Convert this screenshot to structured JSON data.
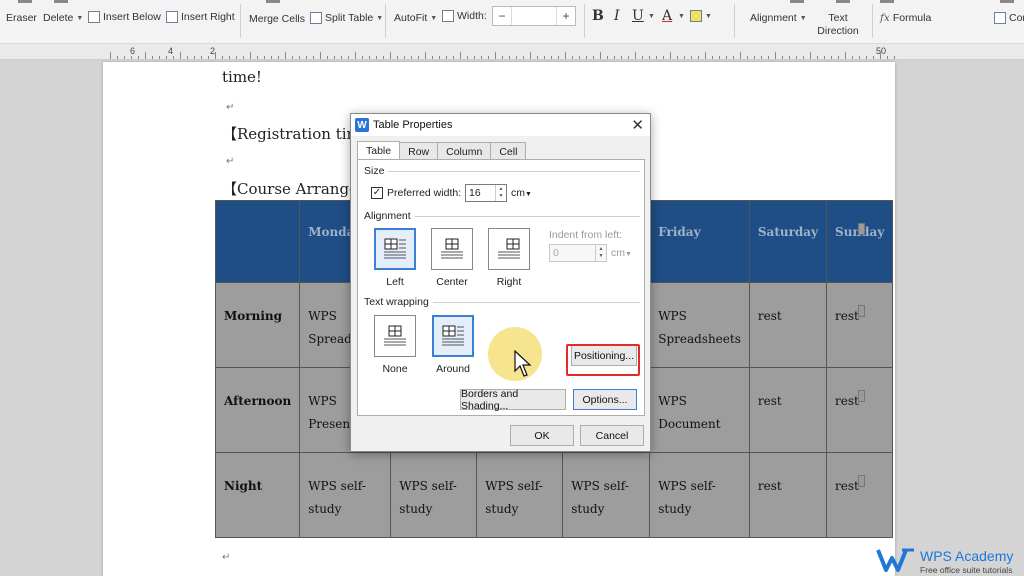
{
  "toolbar": {
    "eraser": "Eraser",
    "delete": "Delete",
    "insert_below": "Insert Below",
    "insert_right": "Insert Right",
    "merge_cells": "Merge Cells",
    "split_table": "Split Table",
    "autofit": "AutoFit",
    "width_label": "Width:",
    "width_minus": "−",
    "width_plus": "+",
    "width_value": "",
    "bold": "B",
    "italic": "I",
    "underline": "U",
    "font_color": "A",
    "alignment": "Alignment",
    "text_direction": "Text Direction",
    "formula": "Formula",
    "formula_prefix": "fx",
    "convert": "Conv"
  },
  "ruler": {
    "numbers": [
      "6",
      "4",
      "2",
      "50"
    ]
  },
  "document": {
    "line1": "time!",
    "line2": "【Registration tim",
    "line3": "【Course Arranger",
    "para_mark": "↵"
  },
  "table": {
    "headers": [
      "",
      "Monday",
      "",
      "",
      "",
      "Friday",
      "Saturday",
      "Sunday"
    ],
    "rows": [
      {
        "head": "Morning",
        "cells": [
          "WPS",
          "",
          "",
          "",
          "WPS",
          "rest",
          "rest"
        ],
        "cells2": [
          "Spreadshe",
          "",
          "",
          "",
          "Spreadsheets",
          "",
          ""
        ]
      },
      {
        "head": "Afternoon",
        "cells": [
          "WPS",
          "",
          "",
          "",
          "WPS",
          "rest",
          "rest"
        ],
        "cells2": [
          "Presentati",
          "",
          "",
          "",
          "Document",
          "",
          ""
        ]
      },
      {
        "head": "Night",
        "cells": [
          "WPS self-",
          "WPS self-",
          "WPS self-",
          "WPS self-",
          "WPS self-",
          "rest",
          "rest"
        ],
        "cells2": [
          "study",
          "study",
          "study",
          "study",
          "study",
          "",
          ""
        ]
      }
    ]
  },
  "dialog": {
    "title": "Table Properties",
    "app_icon": "W",
    "tabs": [
      "Table",
      "Row",
      "Column",
      "Cell"
    ],
    "size_group": "Size",
    "preferred_width_label": "Preferred width:",
    "preferred_width_checked": true,
    "preferred_width_value": "16",
    "preferred_width_unit": "cm",
    "alignment_group": "Alignment",
    "alignment_options": [
      "Left",
      "Center",
      "Right"
    ],
    "alignment_selected": "Left",
    "indent_label": "Indent from left:",
    "indent_value": "0",
    "indent_unit": "cm",
    "text_wrapping_group": "Text wrapping",
    "wrapping_options": [
      "None",
      "Around"
    ],
    "wrapping_selected": "Around",
    "positioning_button": "Positioning...",
    "borders_button": "Borders and Shading...",
    "options_button": "Options...",
    "ok_button": "OK",
    "cancel_button": "Cancel"
  },
  "branding": {
    "name": "WPS Academy",
    "tagline": "Free office suite tutorials"
  },
  "colors": {
    "table_header": "#1f4e86",
    "table_cell": "#9d9d9d",
    "highlight": "#e12a2a",
    "brand_blue": "#1e78d6",
    "cursor_glow": "#f6df7a"
  }
}
